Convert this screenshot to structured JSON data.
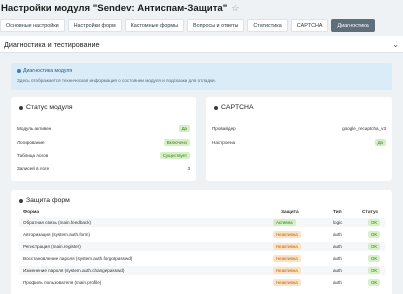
{
  "header": {
    "title": "Настройки модуля \"Sendev: Антиспам-Защита\""
  },
  "tabs": [
    {
      "label": "Основные настройки",
      "active": false
    },
    {
      "label": "Настройки форм",
      "active": false
    },
    {
      "label": "Кастомные формы",
      "active": false
    },
    {
      "label": "Вопросы и ответы",
      "active": false
    },
    {
      "label": "Статистика",
      "active": false
    },
    {
      "label": "CAPTCHA",
      "active": false
    },
    {
      "label": "Диагностика",
      "active": true
    }
  ],
  "section": {
    "title": "Диагностика и тестирование"
  },
  "info": {
    "title": "Диагностика модуля",
    "text": "Здесь отображается техническая информация о состоянии модуля и подсказки для отладки."
  },
  "status": {
    "title": "Статус модуля",
    "rows": [
      {
        "label": "Модуль активен",
        "value": "Да",
        "badge": "green"
      },
      {
        "label": "Логирование",
        "value": "Включено",
        "badge": "green"
      },
      {
        "label": "Таблица логов",
        "value": "Существует",
        "badge": "green"
      },
      {
        "label": "Записей в логе",
        "value": "3",
        "badge": ""
      }
    ]
  },
  "captcha": {
    "title": "CAPTCHA",
    "rows": [
      {
        "label": "Провайдер",
        "value": "google_recaptcha_v3",
        "badge": ""
      },
      {
        "label": "Настроена",
        "value": "Да",
        "badge": "green"
      }
    ]
  },
  "forms": {
    "title": "Защита форм",
    "columns": {
      "form": "Форма",
      "protection": "Защита",
      "type": "Тип",
      "status": "Статус"
    },
    "rows": [
      {
        "form": "Обратная связь (main.feedback)",
        "protection": "Активна",
        "prot_color": "green",
        "type": "logic",
        "status": "OK"
      },
      {
        "form": "Авторизация (system.auth.form)",
        "protection": "Неактивна",
        "prot_color": "orange",
        "type": "auth",
        "status": "OK"
      },
      {
        "form": "Регистрация (main.register)",
        "protection": "Неактивна",
        "prot_color": "orange",
        "type": "auth",
        "status": "OK"
      },
      {
        "form": "Восстановление пароля (system.auth.forgotpasswd)",
        "protection": "Неактивна",
        "prot_color": "orange",
        "type": "auth",
        "status": "OK"
      },
      {
        "form": "Изменение пароля (system.auth.changepasswd)",
        "protection": "Неактивна",
        "prot_color": "orange",
        "type": "auth",
        "status": "OK"
      },
      {
        "form": "Профиль пользователя (main.profile)",
        "protection": "Неактивна",
        "prot_color": "orange",
        "type": "auth",
        "status": "OK"
      }
    ]
  }
}
